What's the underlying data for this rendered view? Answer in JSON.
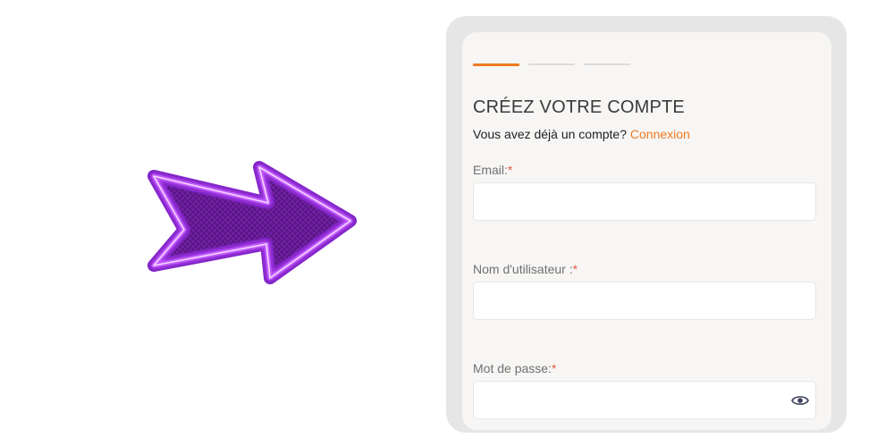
{
  "signup": {
    "title": "CRÉEZ VOTRE COMPTE",
    "have_account_text": "Vous avez déjà un compte?",
    "login_link": "Connexion",
    "steps": {
      "total": 3,
      "active": 1
    },
    "fields": {
      "email": {
        "label": "Email:",
        "required_mark": "*",
        "value": ""
      },
      "username": {
        "label": "Nom d'utilisateur :",
        "required_mark": "*",
        "value": ""
      },
      "password": {
        "label": "Mot de passe:",
        "required_mark": "*",
        "value": "",
        "toggle_icon": "eye-icon"
      }
    }
  },
  "colors": {
    "accent": "#f07a22",
    "required": "#e35b45",
    "neon": "#b23cf0"
  },
  "decor": {
    "arrow_icon": "neon-arrow-icon"
  }
}
